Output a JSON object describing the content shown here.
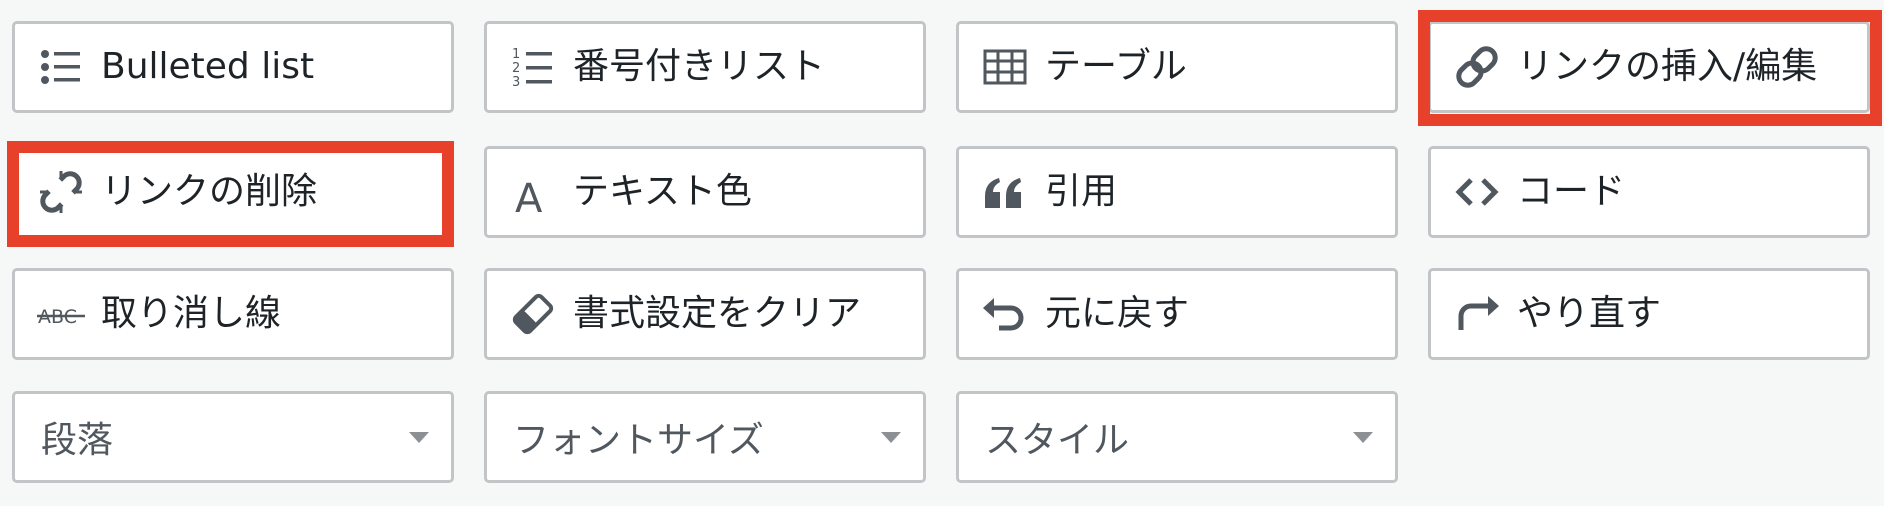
{
  "toolbar": {
    "buttons": [
      {
        "label": "Bulleted list",
        "icon": "bulleted-list-icon"
      },
      {
        "label": "番号付きリスト",
        "icon": "numbered-list-icon"
      },
      {
        "label": "テーブル",
        "icon": "table-icon"
      },
      {
        "label": "リンクの挿入/編集",
        "icon": "link-icon"
      },
      {
        "label": "リンクの削除",
        "icon": "unlink-icon"
      },
      {
        "label": "テキスト色",
        "icon": "text-color-icon"
      },
      {
        "label": "引用",
        "icon": "blockquote-icon"
      },
      {
        "label": "コード",
        "icon": "code-icon"
      },
      {
        "label": "取り消し線",
        "icon": "strikethrough-icon"
      },
      {
        "label": "書式設定をクリア",
        "icon": "eraser-icon"
      },
      {
        "label": "元に戻す",
        "icon": "undo-icon"
      },
      {
        "label": "やり直す",
        "icon": "redo-icon"
      }
    ],
    "selects": [
      {
        "value": "段落"
      },
      {
        "value": "フォントサイズ"
      },
      {
        "value": "スタイル"
      }
    ],
    "strike_icon_text": "ABC",
    "text_color_icon_text": "A"
  },
  "colors": {
    "highlight": "#e8412b",
    "border": "#c3c4c7",
    "icon": "#50575e",
    "background": "#f6f7f7"
  }
}
